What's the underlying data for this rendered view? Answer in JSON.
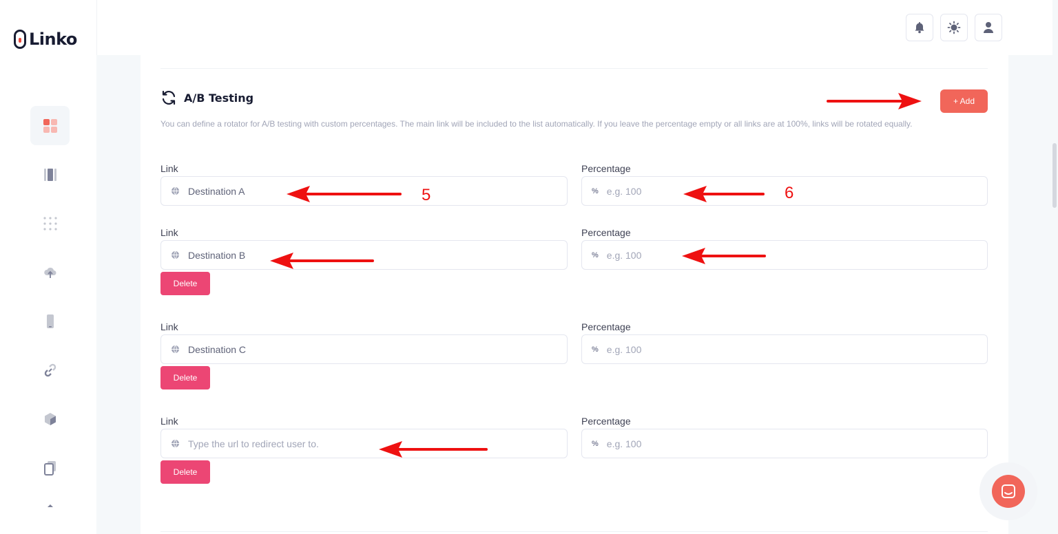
{
  "app": {
    "logo_text": "Linko"
  },
  "colors": {
    "accent": "#f1665a",
    "delete": "#ec4674",
    "annotation": "#ee1111"
  },
  "sidebar": {
    "items": [
      {
        "name": "dashboard",
        "icon": "grid-icon",
        "active": true
      },
      {
        "name": "pages",
        "icon": "columns-icon",
        "active": false
      },
      {
        "name": "apps",
        "icon": "dots-grid-icon",
        "active": false
      },
      {
        "name": "upload",
        "icon": "cloud-upload-icon",
        "active": false
      },
      {
        "name": "mobile",
        "icon": "phone-icon",
        "active": false
      },
      {
        "name": "links",
        "icon": "link-icon",
        "active": false
      },
      {
        "name": "products",
        "icon": "cube-icon",
        "active": false
      },
      {
        "name": "copies",
        "icon": "copy-icon",
        "active": false
      },
      {
        "name": "more",
        "icon": "chevron-up-icon",
        "active": false
      }
    ]
  },
  "header": {
    "buttons": [
      {
        "name": "notifications",
        "icon": "bell-icon"
      },
      {
        "name": "theme",
        "icon": "sun-icon"
      },
      {
        "name": "account",
        "icon": "user-icon"
      }
    ]
  },
  "ab_testing": {
    "title": "A/B Testing",
    "add_label": "+ Add",
    "description": "You can define a rotator for A/B testing with custom percentages. The main link will be included to the list automatically. If you leave the percentage empty or all links are at 100%, links will be rotated equally.",
    "link_label": "Link",
    "percentage_label": "Percentage",
    "delete_label": "Delete",
    "link_placeholder": "Type the url to redirect user to.",
    "percentage_placeholder": "e.g. 100",
    "rows": [
      {
        "link_value": "Destination A",
        "has_delete": false
      },
      {
        "link_value": "Destination B",
        "has_delete": true
      },
      {
        "link_value": "Destination C",
        "has_delete": true
      },
      {
        "link_value": "",
        "has_delete": true
      }
    ]
  },
  "annotations": {
    "label_5": "5",
    "label_6": "6"
  }
}
